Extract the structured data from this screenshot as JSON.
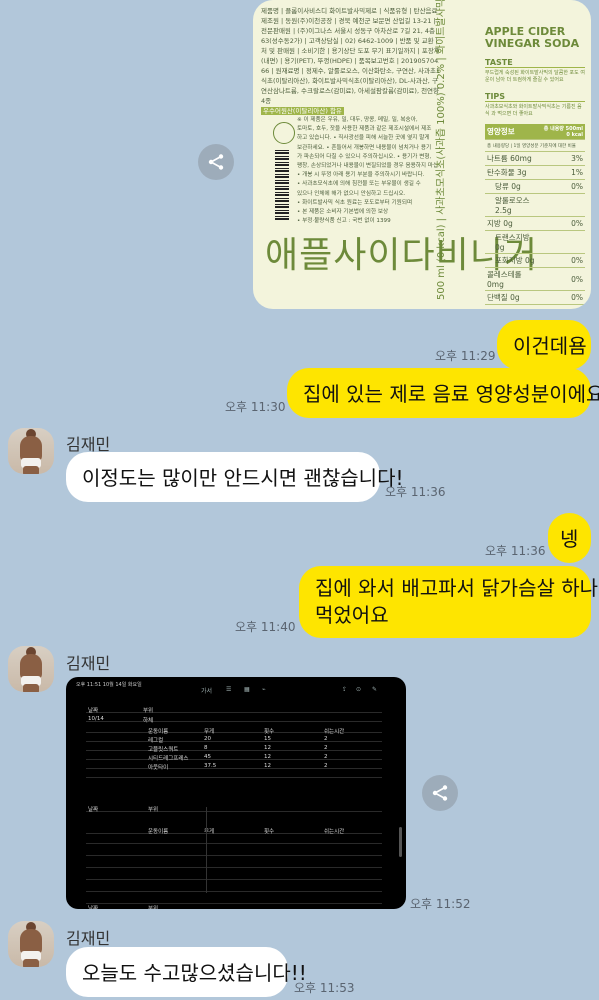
{
  "messages": {
    "m1": {
      "text": "이건데욤",
      "time": "오후 11:29"
    },
    "m2": {
      "text": "집에 있는 제로 음료 영양성분이에요!",
      "time": "오후 11:30"
    },
    "m3": {
      "sender": "김재민",
      "text": "이정도는 많이만 안드시면 괜찮습니다!",
      "time": "오후 11:36"
    },
    "m4": {
      "text": "넹",
      "time": "오후 11:36"
    },
    "m5": {
      "line1": "집에 와서 배고파서 닭가슴살 하나",
      "line2": "먹었어요",
      "time": "오후 11:40"
    },
    "m6": {
      "sender": "김재민",
      "time": "오후 11:52"
    },
    "m7": {
      "sender": "김재민",
      "text": "오늘도 수고많으셨습니다!!",
      "time": "오후 11:53"
    }
  },
  "label_image": {
    "left_lines": [
      "제품명 | 플롬이사비스디 화이트발사믹제로 | 식품유형 | 탄산음료",
      "제조원 | 동원(주)이천공장 | 경북 예천군 보문면 산업길 13-21 | 유통",
      "전문판매원 | (주)이그나스 서울시 성동구 아차산로 7길 21, 4층",
      "63(성수동2가) | 고객상담실 | 02) 6462-1009 | 반품 및 교환 | 구입",
      "처 및 판매원 | 소비기한 | 용기상단 도포 무기 표기일까지 | 포장재질",
      "(내면) | 용기(PET), 뚜껑(HDPE) | 품목보고번호 | 20190570427",
      "66 | 원재료명 | 정제수, 알룰로오스, 이산화탄소, 구연산, 사과초모",
      "식초(이탈리아산), 화이트발사믹식초(이탈리아산), DL-사과산, 구",
      "연산삼나트륨, 수크랄로스(감미료), 아세설팜칼륨(감미료), 천연향료",
      "4종"
    ],
    "left_highlight": "우수어원산(이탈리아산) 함유",
    "left_notes": [
      "※ 이 제품은 우유, 밀, 대두, 땅콩, 메밀, 밀, 복숭아,",
      "토마토, 호두, 잣을 사용한 제품과 같은 제조시설에서 제조",
      "하고 있습니다. • 직사광선을 피해 서늘한 곳에 옆지 말게",
      "보관하세요. • 흔들어서 개봉하면 내용물이 넘치거나 용기",
      "가 파손되어 다칠 수 있으니 주의하십시오. • 용기가 변형,",
      "팽창, 손상되었거나 내용물이 변질되었을 경우 음용하지 마십시오.",
      "• 개봉 시 뚜껑 아래 용기 부분을 주의하시기 바랍니다.",
      "• 사과초모식초에 의해 침전물 또는 부유물이 생길 수",
      "있으나 인체에 해가 없으니 안심하고 드십시오.",
      "• 화이트발사믹 식초 원료는 포도로부터 기원되며",
      "• 본 제품은 소비자 기본법에 의한 보상",
      "• 부정·불량식품 신고 : 국번 없이 1399"
    ],
    "brand": "애플사이다비니거",
    "vertical": "500 ml (0 kcal) | 사과초모식초(사과즙 100%) 0.2% | 화이트발사믹식초(포도 100%) 0.02%",
    "title1": "APPLE CIDER",
    "title2": "VINEGAR SODA",
    "taste_heading": "TASTE",
    "taste_text": "부드럽게 숙성된 화이트발사믹의 달콤한 포도 여운이 남아 더 트컴하게 즐길 수 있어요",
    "tips_heading": "TIPS",
    "tips_text": "사과초모식초와 화이트발사믹식초는 기름진 음식 과 먹으면 더 좋아요",
    "nutrition_header": "영양정보",
    "nutrition_serving": "총 내용량 500ml 0 kcal",
    "nutrition_sub": "총 내용량당 | 1일 영양성분 기준치에 대한 비율",
    "nutrition": [
      {
        "name": "나트륨",
        "amount": "60mg",
        "pct": "3%"
      },
      {
        "name": "탄수화물",
        "amount": "3g",
        "pct": "1%"
      },
      {
        "name": "당류",
        "amount": "0g",
        "pct": "0%"
      },
      {
        "name": "알룰로오스",
        "amount": "2.5g",
        "pct": ""
      },
      {
        "name": "지방",
        "amount": "0g",
        "pct": "0%"
      },
      {
        "name": "트랜스지방",
        "amount": "0g",
        "pct": ""
      },
      {
        "name": "포화지방",
        "amount": "0g",
        "pct": "0%"
      },
      {
        "name": "콜레스테롤",
        "amount": "0mg",
        "pct": "0%"
      },
      {
        "name": "단백질",
        "amount": "0g",
        "pct": "0%"
      }
    ]
  },
  "tablet": {
    "status": "오후 11:51  10월 14일 화요일",
    "toolbar_title": "가서",
    "rows": [
      [
        "날짜",
        "부위",
        "",
        "",
        ""
      ],
      [
        "10/14",
        "하체",
        "",
        "",
        ""
      ],
      [
        "",
        "운동이름",
        "무게",
        "횟수",
        "쉬는시간"
      ],
      [
        "",
        "레그컬",
        "20",
        "15",
        "2"
      ],
      [
        "",
        "고블릿스쿼트",
        "8",
        "12",
        "2"
      ],
      [
        "",
        "시티드레그프레스",
        "45",
        "12",
        "2"
      ],
      [
        "",
        "아웃타이",
        "37.5",
        "12",
        "2"
      ],
      [
        "날짜",
        "부위",
        "",
        "",
        ""
      ],
      [
        "",
        "운동이름",
        "무게",
        "횟수",
        "쉬는시간"
      ],
      [
        "날짜",
        "부위",
        "",
        "",
        ""
      ]
    ]
  }
}
